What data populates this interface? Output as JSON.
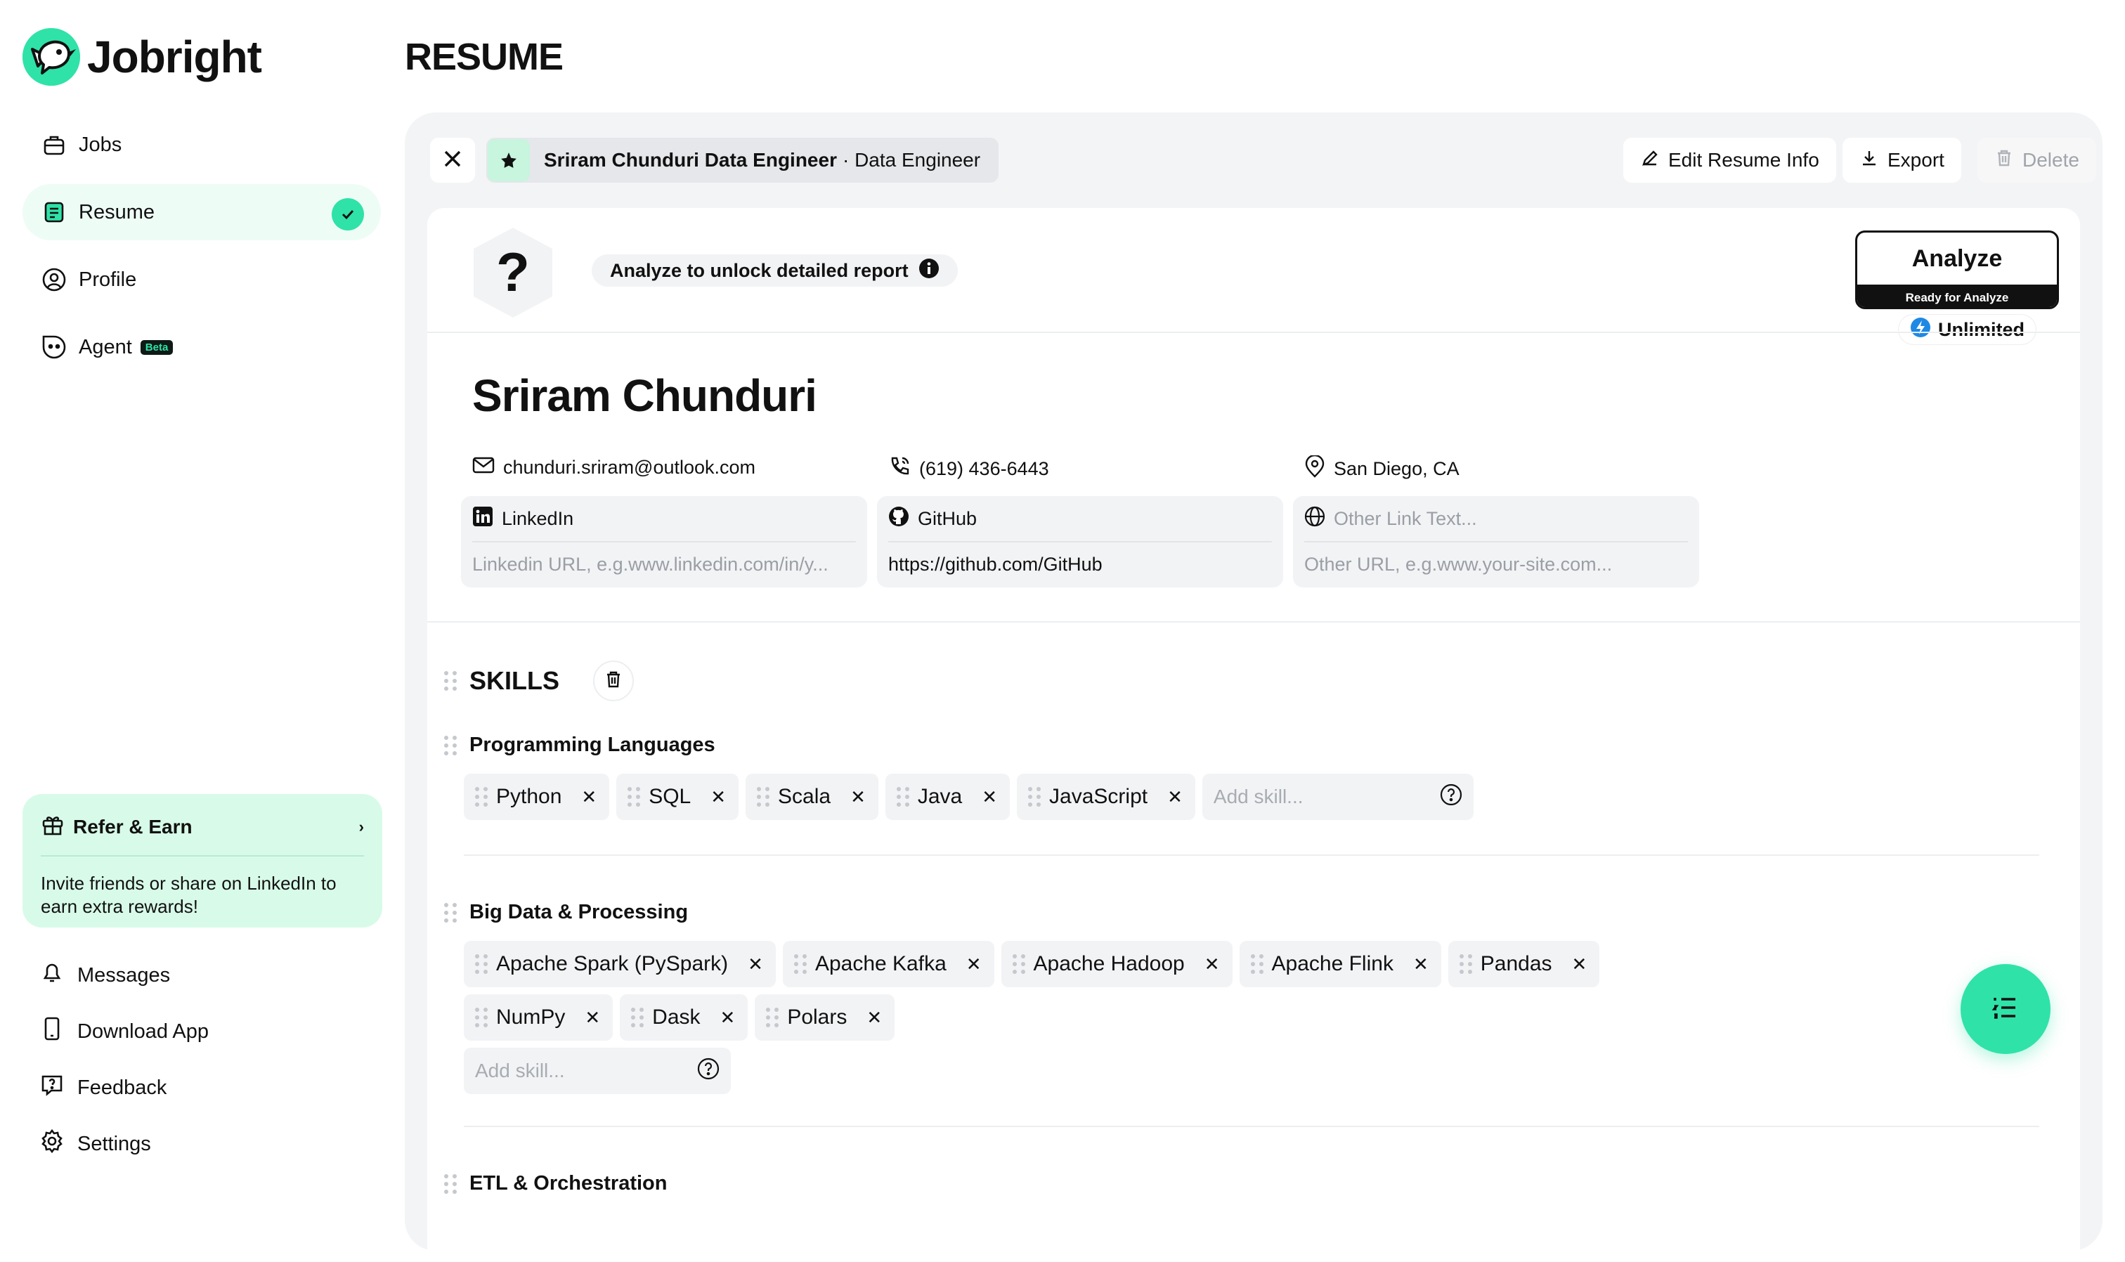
{
  "brand": {
    "name": "Jobright"
  },
  "sidebar": {
    "items": [
      {
        "label": "Jobs",
        "icon": "briefcase-icon"
      },
      {
        "label": "Resume",
        "icon": "resume-icon"
      },
      {
        "label": "Profile",
        "icon": "user-circle-icon"
      },
      {
        "label": "Agent",
        "icon": "robot-face-icon",
        "badge": "Beta"
      }
    ],
    "refer": {
      "title": "Refer & Earn",
      "description": "Invite friends or share on LinkedIn to earn extra rewards!"
    },
    "bottom": [
      {
        "label": "Messages",
        "icon": "bell-icon"
      },
      {
        "label": "Download App",
        "icon": "phone-icon"
      },
      {
        "label": "Feedback",
        "icon": "feedback-icon"
      },
      {
        "label": "Settings",
        "icon": "gear-icon"
      }
    ]
  },
  "page": {
    "title": "RESUME"
  },
  "toolbar": {
    "resume_name": "Sriram Chunduri Data Engineer",
    "resume_role": "· Data Engineer",
    "edit_label": "Edit Resume Info",
    "export_label": "Export",
    "delete_label": "Delete"
  },
  "analyze": {
    "score_placeholder": "?",
    "unlock_text": "Analyze to unlock detailed report",
    "button_label": "Analyze",
    "button_sub": "Ready for Analyze",
    "plan": "Unlimited"
  },
  "resume": {
    "name": "Sriram Chunduri",
    "email": "chunduri.sriram@outlook.com",
    "phone": "(619) 436-6443",
    "location": "San Diego, CA",
    "links": [
      {
        "label": "LinkedIn",
        "url_placeholder": "Linkedin URL, e.g.www.linkedin.com/in/y...",
        "url": ""
      },
      {
        "label": "GitHub",
        "url_placeholder": "",
        "url": "https://github.com/GitHub"
      },
      {
        "label_placeholder": "Other Link Text...",
        "url_placeholder": "Other URL, e.g.www.your-site.com..."
      }
    ]
  },
  "skills": {
    "title": "SKILLS",
    "add_placeholder": "Add skill...",
    "categories": [
      {
        "name": "Programming Languages",
        "skills": [
          "Python",
          "SQL",
          "Scala",
          "Java",
          "JavaScript"
        ]
      },
      {
        "name": "Big Data & Processing",
        "skills": [
          "Apache Spark (PySpark)",
          "Apache Kafka",
          "Apache Hadoop",
          "Apache Flink",
          "Pandas",
          "NumPy",
          "Dask",
          "Polars"
        ]
      },
      {
        "name": "ETL & Orchestration",
        "skills": []
      }
    ]
  },
  "colors": {
    "accent": "#2fe2a8",
    "accent_light": "#d8fbe9",
    "panel": "#f3f4f6"
  }
}
